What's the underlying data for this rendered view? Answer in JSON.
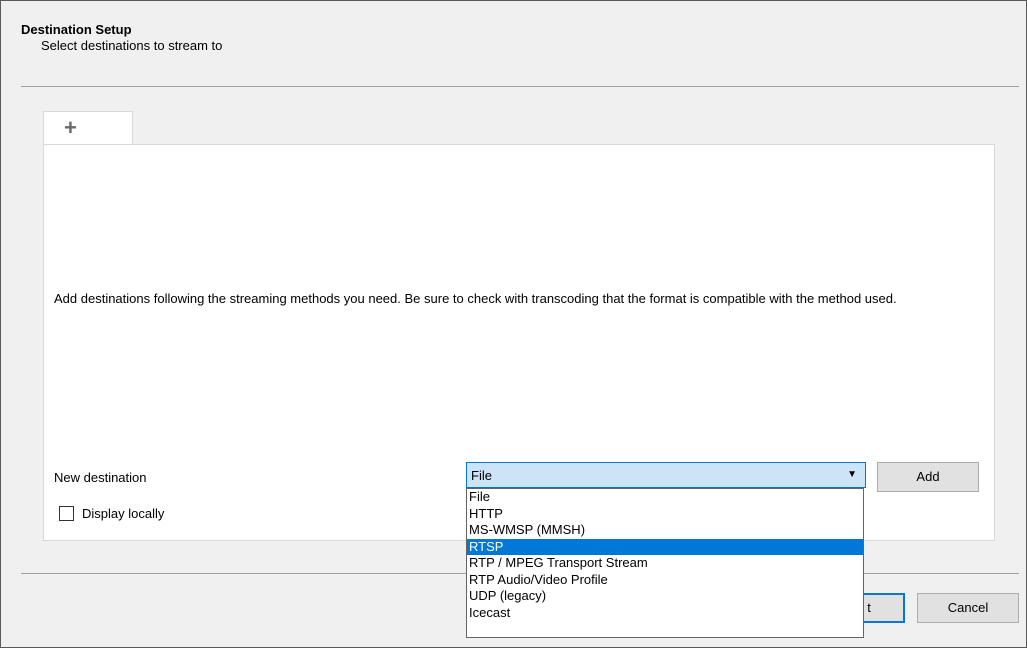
{
  "header": {
    "title": "Destination Setup",
    "subtitle": "Select destinations to stream to"
  },
  "tabs": [
    {
      "icon": "plus-icon",
      "label": "+"
    }
  ],
  "panel": {
    "info": "Add destinations following the streaming methods you need. Be sure to check with transcoding that the format is compatible with the method used.",
    "new_destination_label": "New destination",
    "combo_value": "File",
    "add_label": "Add",
    "display_locally_label": "Display locally",
    "display_locally_checked": false
  },
  "dropdown": {
    "options": [
      "File",
      "HTTP",
      "MS-WMSP (MMSH)",
      "RTSP",
      "RTP / MPEG Transport Stream",
      "RTP Audio/Video Profile",
      "UDP (legacy)",
      "Icecast"
    ],
    "highlighted": "RTSP"
  },
  "footer": {
    "ok_label": "t",
    "cancel_label": "Cancel"
  },
  "colors": {
    "accent": "#0078d7",
    "combo_bg": "#cce4f7",
    "window_bg": "#f0f0f0"
  }
}
